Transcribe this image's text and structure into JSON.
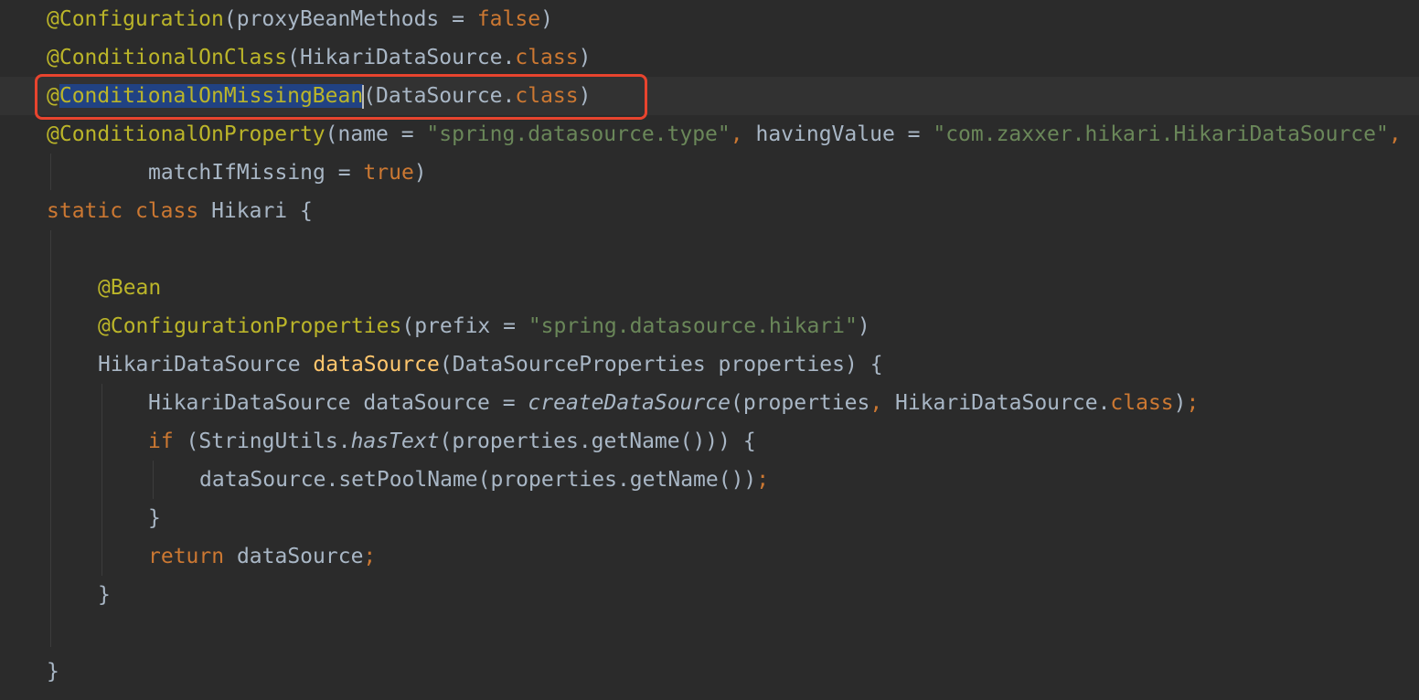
{
  "colors": {
    "background": "#2b2b2b",
    "annotation": "#bbb529",
    "keyword": "#cc7832",
    "string": "#6a8759",
    "method_declaration": "#ffc66d",
    "default_text": "#a9b7c6",
    "selection": "#214283",
    "highlight_box": "#e8442e"
  },
  "code": {
    "line1": {
      "annotation": "@Configuration",
      "open": "(proxyBeanMethods = ",
      "value": "false",
      "close": ")"
    },
    "line2": {
      "annotation": "@ConditionalOnClass",
      "open": "(HikariDataSource.",
      "kw": "class",
      "close": ")"
    },
    "line3": {
      "at": "@",
      "selected": "ConditionalOnMissingBean",
      "open": "(DataSource.",
      "kw": "class",
      "close": ")"
    },
    "line4": {
      "annotation": "@ConditionalOnProperty",
      "open": "(name = ",
      "name_value": "\"spring.datasource.type\"",
      "comma": ",",
      "having": " havingValue = ",
      "having_value": "\"com.zaxxer.hikari.HikariDataSource\"",
      "end": ","
    },
    "line5": {
      "text": "matchIfMissing = ",
      "value": "true",
      "close": ")"
    },
    "line6": {
      "kw1": "static",
      "kw2": "class",
      "name": "Hikari {"
    },
    "line8": {
      "annotation": "@Bean"
    },
    "line9": {
      "annotation": "@ConfigurationProperties",
      "open": "(prefix = ",
      "value": "\"spring.datasource.hikari\"",
      "close": ")"
    },
    "line10": {
      "type": "HikariDataSource ",
      "method": "dataSource",
      "params": "(DataSourceProperties properties) {"
    },
    "line11": {
      "text": "HikariDataSource dataSource = ",
      "call": "createDataSource",
      "args": "(properties",
      "comma": ",",
      "args2": " HikariDataSource.",
      "kw": "class",
      "close": ")",
      "semi": ";"
    },
    "line12": {
      "kw": "if",
      "open": " (StringUtils.",
      "call": "hasText",
      "rest": "(properties.getName())) {"
    },
    "line13": {
      "text": "dataSource.setPoolName(properties.getName())",
      "semi": ";"
    },
    "line14": {
      "text": "}"
    },
    "line15": {
      "kw": "return",
      "text": " dataSource",
      "semi": ";"
    },
    "line16": {
      "text": "}"
    },
    "line18": {
      "text": "}"
    }
  }
}
